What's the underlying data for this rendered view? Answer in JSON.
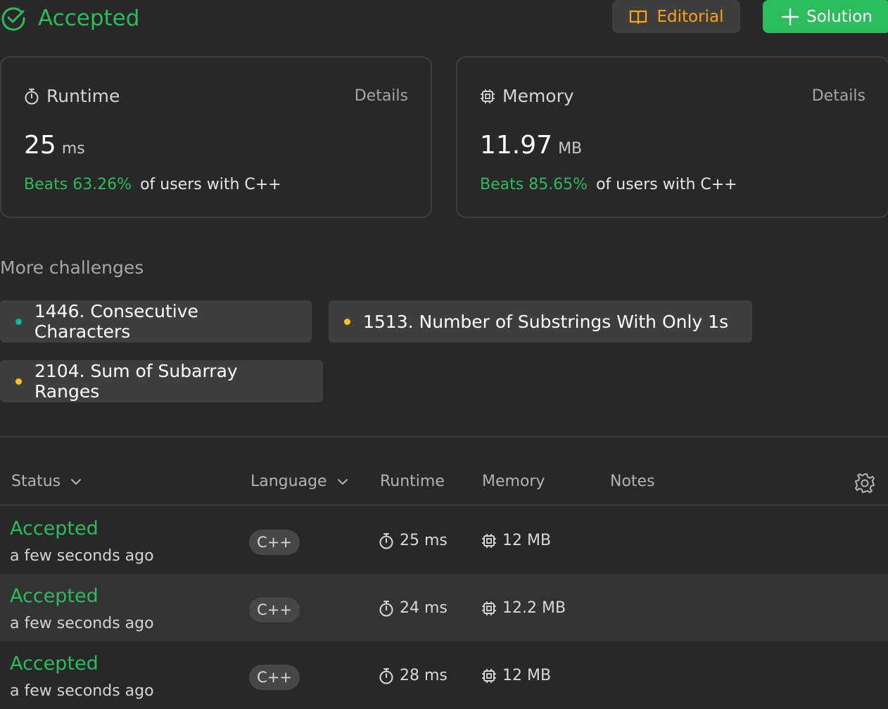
{
  "header": {
    "status": "Accepted",
    "editorial_label": "Editorial",
    "solution_label": "Solution"
  },
  "runtime_card": {
    "title": "Runtime",
    "details": "Details",
    "value": "25",
    "unit": "ms",
    "beats": "Beats 63.26%",
    "suffix": "of users with C++"
  },
  "memory_card": {
    "title": "Memory",
    "details": "Details",
    "value": "11.97",
    "unit": "MB",
    "beats": "Beats 85.65%",
    "suffix": "of users with C++"
  },
  "more_challenges": {
    "title": "More challenges",
    "items": [
      {
        "label": "1446. Consecutive Characters",
        "difficulty_color": "#00b8a3"
      },
      {
        "label": "1513. Number of Substrings With Only 1s",
        "difficulty_color": "#ffc01e"
      },
      {
        "label": "2104. Sum of Subarray Ranges",
        "difficulty_color": "#ffc01e"
      }
    ]
  },
  "table": {
    "headers": {
      "status": "Status",
      "language": "Language",
      "runtime": "Runtime",
      "memory": "Memory",
      "notes": "Notes"
    },
    "rows": [
      {
        "status": "Accepted",
        "time": "a few seconds ago",
        "language": "C++",
        "runtime": "25 ms",
        "memory": "12 MB"
      },
      {
        "status": "Accepted",
        "time": "a few seconds ago",
        "language": "C++",
        "runtime": "24 ms",
        "memory": "12.2 MB"
      },
      {
        "status": "Accepted",
        "time": "a few seconds ago",
        "language": "C++",
        "runtime": "28 ms",
        "memory": "12 MB"
      }
    ]
  },
  "colors": {
    "accent_green": "#2cbb5d",
    "editorial_orange": "#ffa116",
    "background": "#282828"
  },
  "icons": [
    "check-circle-icon",
    "book-icon",
    "plus-icon",
    "stopwatch-icon",
    "chip-icon",
    "chevron-down-icon",
    "gear-icon"
  ]
}
